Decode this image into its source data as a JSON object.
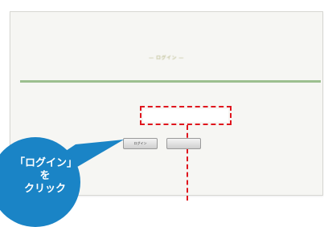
{
  "dialog": {
    "heading": "ログイン",
    "message_lines": [
      "",
      "",
      "",
      ""
    ],
    "password_label": "",
    "login_button": "ログイン",
    "cancel_button": ""
  },
  "callout": {
    "line1": "「ログイン」",
    "line2": "を",
    "line3": "クリック",
    "color": "#1a84c6"
  },
  "highlight_color": "#e0161e"
}
